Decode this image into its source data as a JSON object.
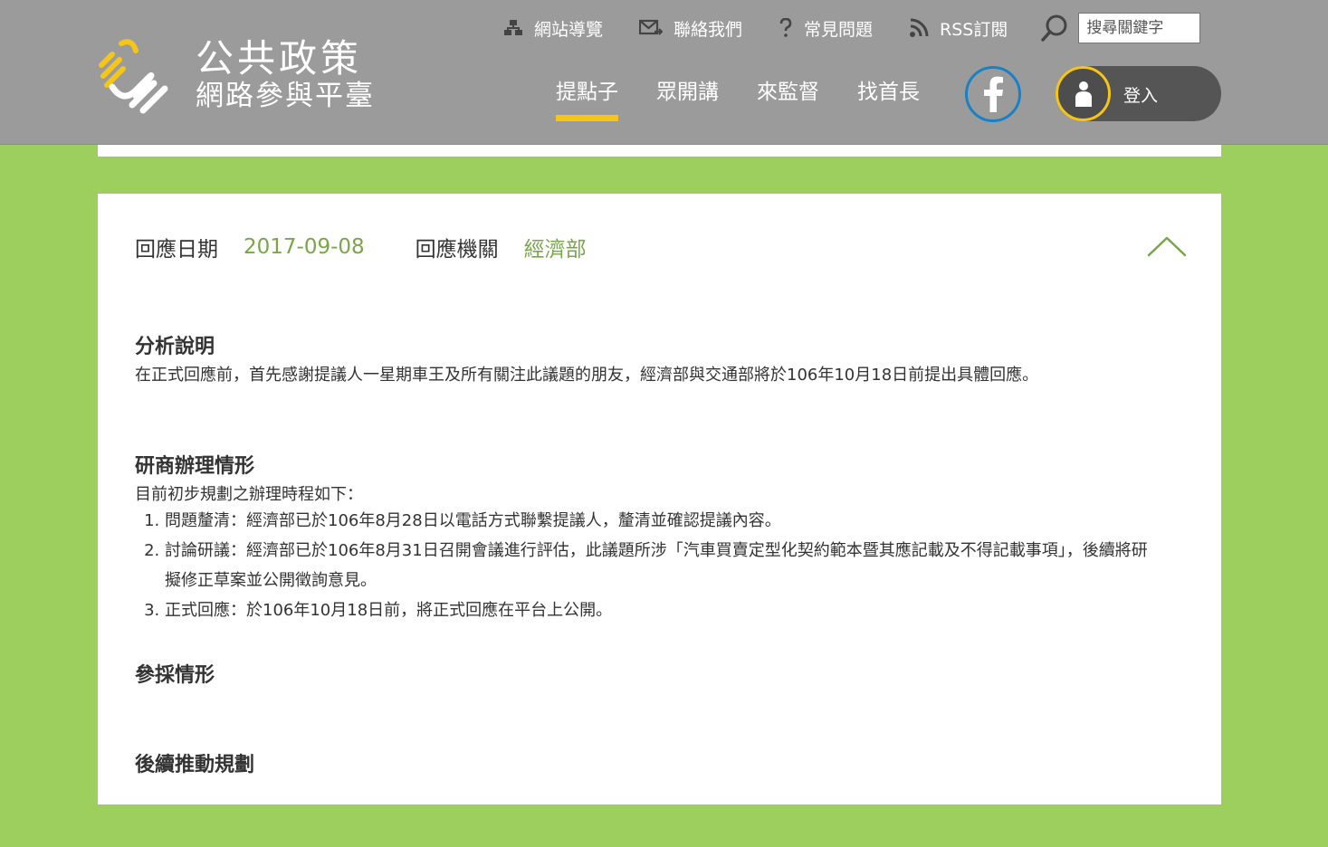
{
  "header": {
    "logo": {
      "line1": "公共政策",
      "line2": "網路參與平臺",
      "mark_color": "#f5c518"
    },
    "util_nav": [
      {
        "label": "網站導覽",
        "icon": "sitemap-icon"
      },
      {
        "label": "聯絡我們",
        "icon": "mail-icon"
      },
      {
        "label": "常見問題",
        "icon": "question-icon"
      },
      {
        "label": "RSS訂閱",
        "icon": "rss-icon"
      }
    ],
    "search": {
      "placeholder": "搜尋關鍵字",
      "icon": "search-icon"
    },
    "main_nav": [
      {
        "label": "提點子",
        "active": true
      },
      {
        "label": "眾開講",
        "active": false
      },
      {
        "label": "來監督",
        "active": false
      },
      {
        "label": "找首長",
        "active": false
      }
    ],
    "facebook": {
      "icon": "facebook-icon",
      "color": "#1a82c4"
    },
    "login": {
      "label": "登入",
      "icon": "user-icon",
      "accent": "#f5c518"
    }
  },
  "response": {
    "date_label": "回應日期",
    "date_value": "2017-09-08",
    "agency_label": "回應機關",
    "agency_value": "經濟部",
    "accent_color": "#7aa64a",
    "collapse_icon": "chevron-up-icon",
    "sections": {
      "analysis": {
        "title": "分析說明",
        "text": "在正式回應前，首先感謝提議人一星期車王及所有關注此議題的朋友，經濟部與交通部將於106年10月18日前提出具體回應。"
      },
      "progress": {
        "title": "研商辦理情形",
        "intro": "目前初步規劃之辦理時程如下：",
        "steps": [
          "問題釐清：經濟部已於106年8月28日以電話方式聯繫提議人，釐清並確認提議內容。",
          "討論研議：經濟部已於106年8月31日召開會議進行評估，此議題所涉「汽車買賣定型化契約範本暨其應記載及不得記載事項」，後續將研擬修正草案並公開徵詢意見。",
          "正式回應：於106年10月18日前，將正式回應在平台上公開。"
        ]
      },
      "adoption": {
        "title": "參採情形"
      },
      "follow_up": {
        "title": "後續推動規劃"
      }
    }
  }
}
